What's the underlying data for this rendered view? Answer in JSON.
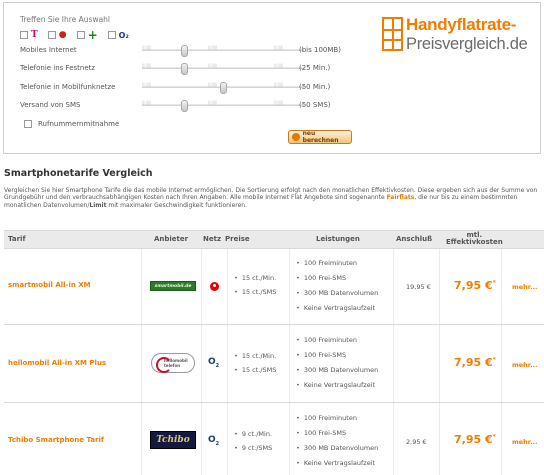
{
  "filter": {
    "title": "Treffen Sie Ihre Auswahl",
    "operators": [
      {
        "icon": "telekom-t-icon",
        "glyph": "T"
      },
      {
        "icon": "vodafone-icon",
        "glyph": "●"
      },
      {
        "icon": "eplus-icon",
        "glyph": "+"
      },
      {
        "icon": "o2-icon",
        "glyph": "O₂"
      }
    ],
    "sliders": [
      {
        "label": "Mobiles Internet",
        "value": "(bis 100MB)",
        "level": 0.25
      },
      {
        "label": "Telefonie ins Festnetz",
        "value": "(25 Min.)",
        "level": 0.25
      },
      {
        "label": "Telefonie in Mobilfunknetze",
        "value": "(50 Min.)",
        "level": 0.5
      },
      {
        "label": "Versand von SMS",
        "value": "(50 SMS)",
        "level": 0.25
      }
    ],
    "rufnummer_label": "Rufnummernmitnahme",
    "calc_button": "neu berechnen"
  },
  "brand": {
    "line1": "Handyflatrate-",
    "line2": "Preisvergleich.de",
    "color": "#ef7d00"
  },
  "section": {
    "title": "Smartphonetarife Vergleich",
    "intro_a": "Vergleichen Sie hier Smartphone Tarife die das mobile Internet ermöglichen. Die Sortierung erfolgt nach den monatlichen Effektivkosten. Diese ergeben sich aus der Summe von Grundgebühr und den verbrauchsabhängigen Kosten nach Ihren Angaben. Alle mobile Internet Flat Angebote sind sogenannte ",
    "intro_link": "Fairflats",
    "intro_b": ", die nur bis zu einem bestimmten monatlichen Datenvolumen/",
    "intro_bold": "Limit",
    "intro_c": " mit maximaler Geschwindigkeit funktionieren."
  },
  "table": {
    "headers": {
      "tarif": "Tarif",
      "anbieter": "Anbieter",
      "netz": "Netz",
      "preise": "Preise",
      "leistungen": "Leistungen",
      "anschluss": "Anschluß",
      "eff1": "mtl.",
      "eff2": "Effektivkosten"
    },
    "rows": [
      {
        "name": "smartmobil All-in XM",
        "logo": "smartmobil.de",
        "netz": "vodafone",
        "preise": [
          "15 ct./Min.",
          "15 ct./SMS"
        ],
        "leistungen": [
          "100 Freiminuten",
          "100 Frei-SMS",
          "300 MB Datenvolumen",
          "Keine Vertragslaufzeit"
        ],
        "anschluss": "19,95 €",
        "eff": "7,95 €",
        "eff_mark": "*",
        "mehr": "mehr..."
      },
      {
        "name": "hellomobil All-in XM Plus",
        "logo": "hellomobil telefon",
        "netz": "o2",
        "preise": [
          "15 ct./Min.",
          "15 ct./SMS"
        ],
        "leistungen": [
          "100 Freiminuten",
          "100 Frei-SMS",
          "300 MB Datenvolumen",
          "Keine Vertragslaufzeit"
        ],
        "anschluss": "",
        "eff": "7,95 €",
        "eff_mark": "*",
        "mehr": "mehr..."
      },
      {
        "name": "Tchibo Smartphone Tarif",
        "logo": "Tchibo",
        "netz": "o2",
        "preise": [
          "9 ct./Min.",
          "9 ct./SMS"
        ],
        "leistungen": [
          "100 Freiminuten",
          "100 Frei-SMS",
          "300 MB Datenvolumen",
          "Keine Vertragslaufzeit"
        ],
        "anschluss": "2,95 €",
        "eff": "7,95 €",
        "eff_mark": "*",
        "mehr": "mehr..."
      }
    ]
  }
}
